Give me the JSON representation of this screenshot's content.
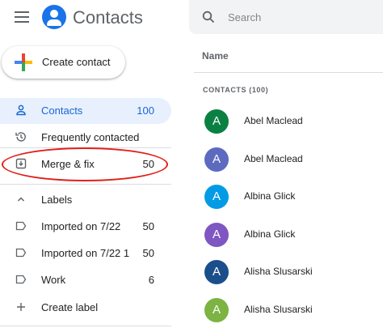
{
  "app": {
    "title": "Contacts"
  },
  "sidebar": {
    "create_label": "Create contact",
    "items": [
      {
        "label": "Contacts",
        "count": "100",
        "icon": "person-icon"
      },
      {
        "label": "Frequently contacted",
        "count": "",
        "icon": "history-icon"
      },
      {
        "label": "Merge & fix",
        "count": "50",
        "icon": "merge-icon"
      }
    ],
    "labels_header": "Labels",
    "labels": [
      {
        "label": "Imported on 7/22",
        "count": "50"
      },
      {
        "label": "Imported on 7/22 1",
        "count": "50"
      },
      {
        "label": "Work",
        "count": "6"
      }
    ],
    "create_label_item": "Create label"
  },
  "search": {
    "placeholder": "Search"
  },
  "main": {
    "column_header": "Name",
    "section_label": "CONTACTS (100)",
    "contacts": [
      {
        "initial": "A",
        "name": "Abel Maclead",
        "color": "#0b8043"
      },
      {
        "initial": "A",
        "name": "Abel Maclead",
        "color": "#5c6bc0"
      },
      {
        "initial": "A",
        "name": "Albina Glick",
        "color": "#039be5"
      },
      {
        "initial": "A",
        "name": "Albina Glick",
        "color": "#7e57c2"
      },
      {
        "initial": "A",
        "name": "Alisha Slusarski",
        "color": "#1a4f8b"
      },
      {
        "initial": "A",
        "name": "Alisha Slusarski",
        "color": "#7cb342"
      }
    ]
  },
  "colors": {
    "accent": "#1967d2",
    "active_bg": "#e8f0fe",
    "annotation": "#e0201a"
  }
}
